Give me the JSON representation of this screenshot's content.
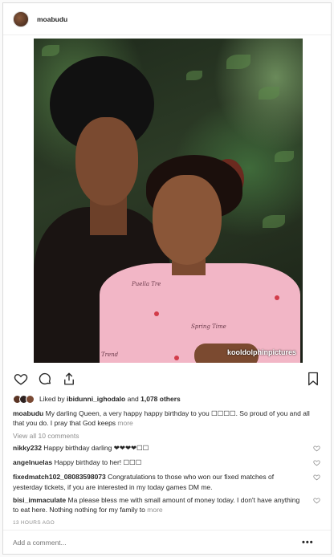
{
  "post": {
    "username": "moabudu",
    "photo_watermark": "kooldolphinpictures",
    "print_words": [
      "Puella Tre",
      "Spring Time",
      "Trend"
    ],
    "liked_by_prefix": "Liked by ",
    "liked_by_user": "ibidunni_ighodalo",
    "liked_by_mid": " and ",
    "liked_by_count": "1,078 others",
    "caption_user": "moabudu",
    "caption_text": " My darling Queen, a very happy happy birthday to you ☐☐☐☐. So proud of you and all that you do. I pray that God keeps ",
    "caption_more": "more",
    "view_all": "View all 10 comments",
    "timestamp": "13 HOURS AGO",
    "add_comment_placeholder": "Add a comment...",
    "options": "•••"
  },
  "comments": [
    {
      "user": "nikky232",
      "text": " Happy birthday darling ❤❤❤❤☐☐"
    },
    {
      "user": "angelnuelas",
      "text": " Happy birthday to her! ☐☐☐"
    },
    {
      "user": "fixedmatch102_08083598073",
      "text": " Congratulations to those who won our fixed matches of yesterday tickets, if you are interested in my today games DM me."
    },
    {
      "user": "bisi_immaculate",
      "text": " Ma please bless me with small amount of money today. I don't have anything to eat here. Nothing nothing for my family to ",
      "more": "more"
    }
  ],
  "icons": {
    "like": "heart-icon",
    "comment": "comment-icon",
    "share": "share-icon",
    "save": "bookmark-icon"
  }
}
